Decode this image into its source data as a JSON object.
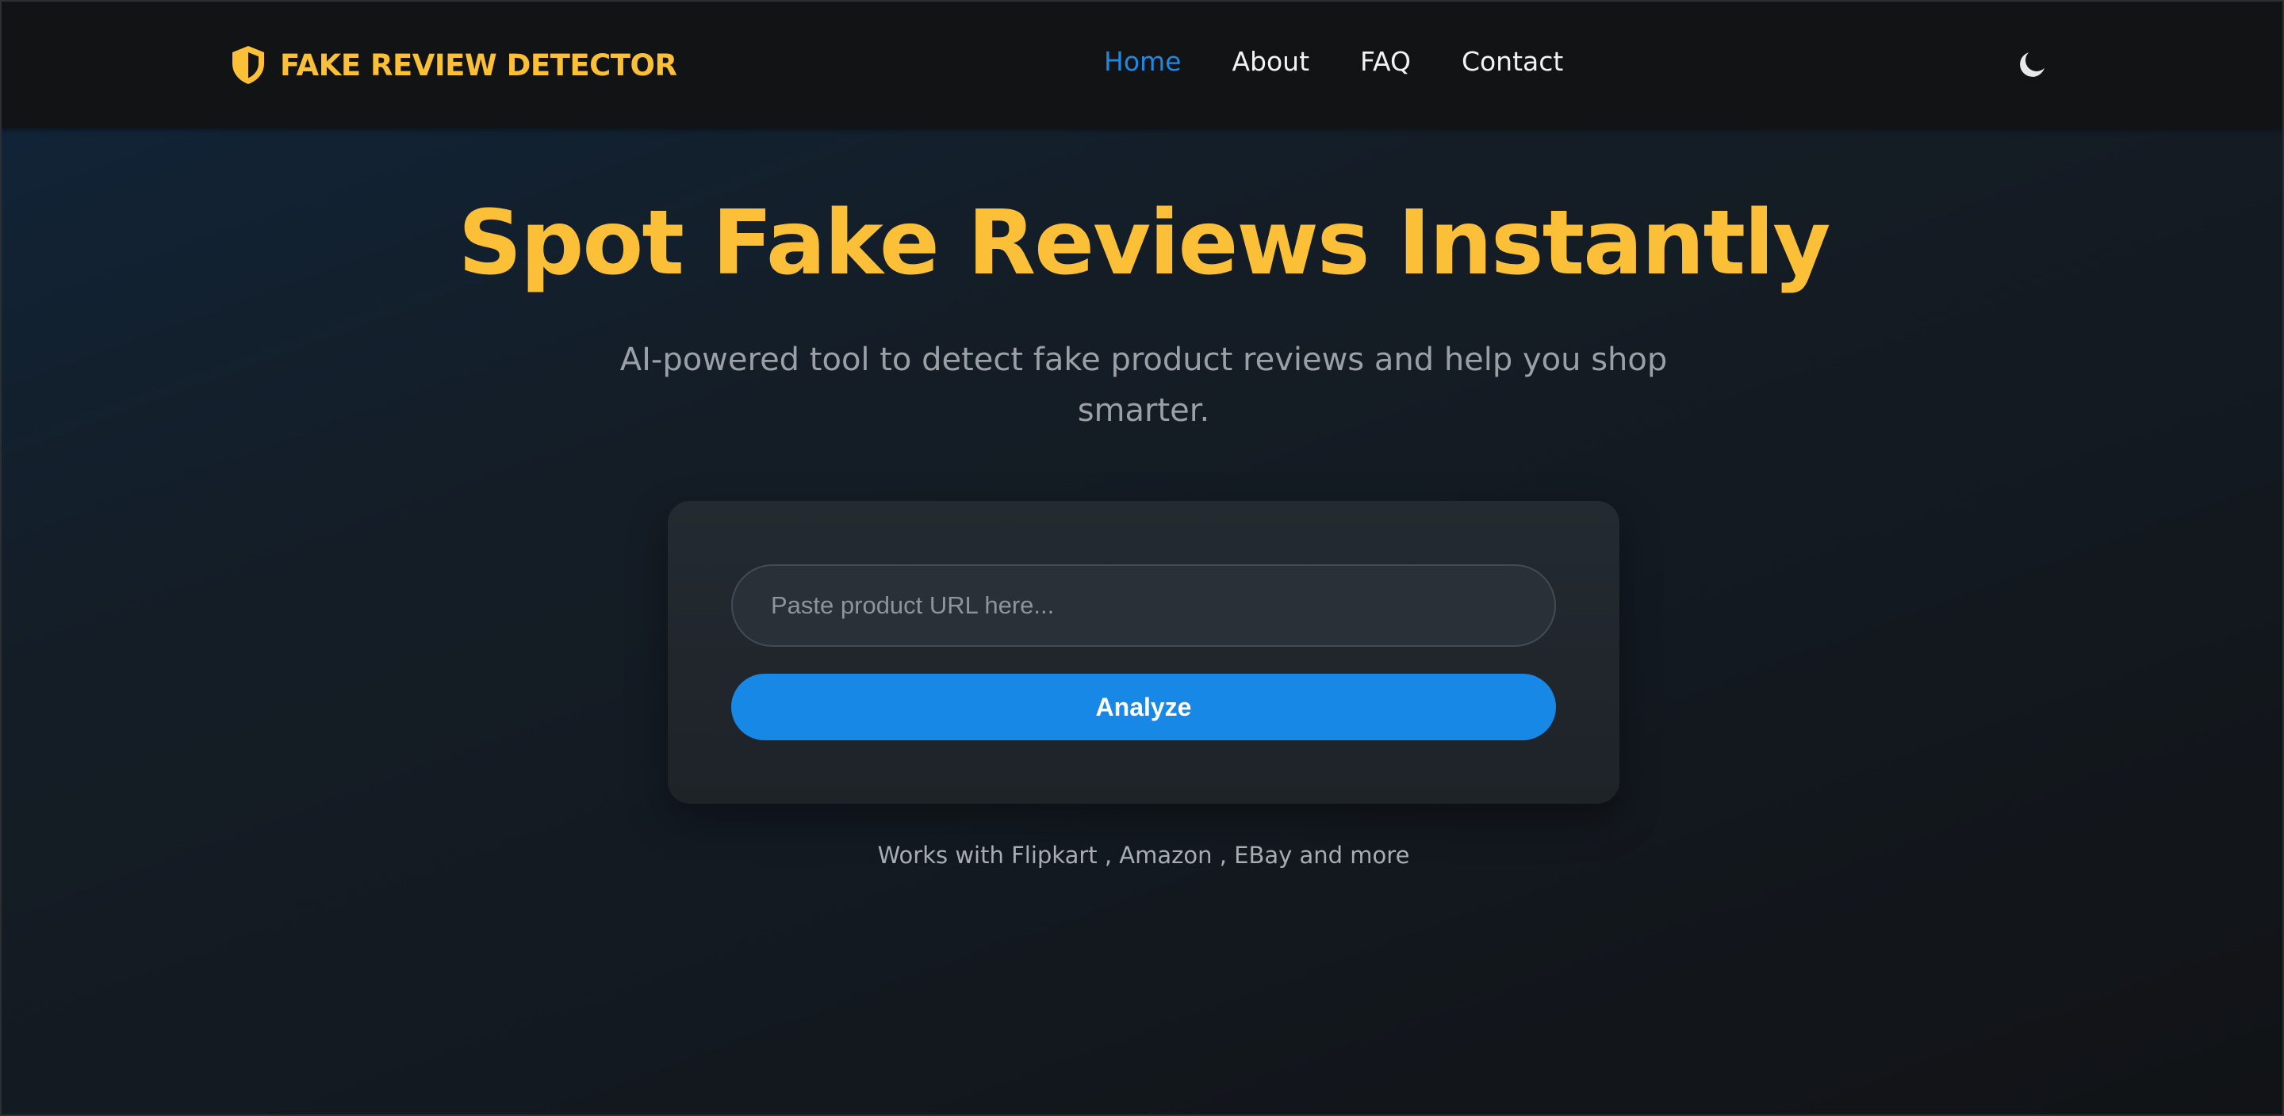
{
  "brand": {
    "name": "FAKE REVIEW DETECTOR",
    "icon": "shield-half-icon"
  },
  "nav": {
    "items": [
      {
        "label": "Home",
        "active": true
      },
      {
        "label": "About",
        "active": false
      },
      {
        "label": "FAQ",
        "active": false
      },
      {
        "label": "Contact",
        "active": false
      }
    ],
    "theme_toggle_icon": "moon-icon"
  },
  "hero": {
    "title": "Spot Fake Reviews Instantly",
    "subtitle": "AI-powered tool to detect fake product reviews and help you shop smarter."
  },
  "analyzer": {
    "url_input": {
      "placeholder": "Paste product URL here...",
      "value": ""
    },
    "button_label": "Analyze"
  },
  "footer_note": "Works with Flipkart , Amazon , EBay and more",
  "colors": {
    "accent": "#fbbf38",
    "primary": "#1788e5",
    "nav_active": "#1e88e5",
    "navbar_bg": "#121315"
  }
}
